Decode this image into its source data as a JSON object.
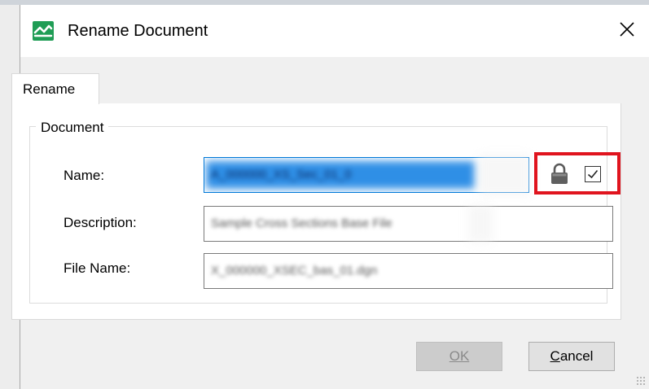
{
  "window": {
    "title": "Rename Document",
    "close_glyph": "✕"
  },
  "tabs": [
    {
      "label": "Rename",
      "active": true
    }
  ],
  "group": {
    "legend": "Document"
  },
  "fields": {
    "name": {
      "label": "Name:",
      "value": "A_000000_XS_Sec_01_0",
      "selected": true
    },
    "description": {
      "label": "Description:",
      "value": "Sample Cross Sections Base File"
    },
    "file_name": {
      "label": "File Name:",
      "value": "X_000000_XSEC_bas_01.dgn"
    }
  },
  "lock_area": {
    "icons": [
      "lock-icon",
      "checkbox-checked-icon"
    ],
    "checkbox_checked": true,
    "highlight_color": "#e0141e"
  },
  "buttons": {
    "ok_label": "OK",
    "ok_enabled": false,
    "cancel_label": "Cancel"
  },
  "colors": {
    "app_icon": "#1f9d55",
    "focus": "#0078d7",
    "selection": "#2f8fe6"
  }
}
